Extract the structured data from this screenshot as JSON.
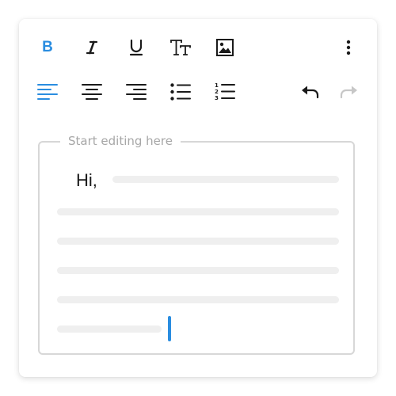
{
  "colors": {
    "accent": "#2a8de0",
    "icon": "#1a1a1a",
    "disabled": "#c7c7c7",
    "border": "#d7d7d7",
    "placeholder_line": "#efefef"
  },
  "toolbar": {
    "row1": [
      {
        "name": "bold",
        "icon": "bold-icon",
        "label": "B",
        "active": true
      },
      {
        "name": "italic",
        "icon": "italic-icon",
        "active": false
      },
      {
        "name": "underline",
        "icon": "underline-icon",
        "active": false
      },
      {
        "name": "text-size",
        "icon": "text-size-icon",
        "active": false
      },
      {
        "name": "image",
        "icon": "image-icon",
        "active": false
      },
      {
        "name": "more",
        "icon": "more-vertical-icon",
        "active": false
      }
    ],
    "row2": [
      {
        "name": "align-left",
        "icon": "align-left-icon",
        "active": true
      },
      {
        "name": "align-center",
        "icon": "align-center-icon",
        "active": false
      },
      {
        "name": "align-right",
        "icon": "align-right-icon",
        "active": false
      },
      {
        "name": "bulleted-list",
        "icon": "bulleted-list-icon",
        "active": false
      },
      {
        "name": "numbered-list",
        "icon": "numbered-list-icon",
        "active": false
      },
      {
        "name": "undo",
        "icon": "undo-icon",
        "enabled": true
      },
      {
        "name": "redo",
        "icon": "redo-icon",
        "enabled": false
      }
    ]
  },
  "editor": {
    "legend": "Start editing here",
    "greeting": "Hi,",
    "placeholder_line_count": 6
  }
}
